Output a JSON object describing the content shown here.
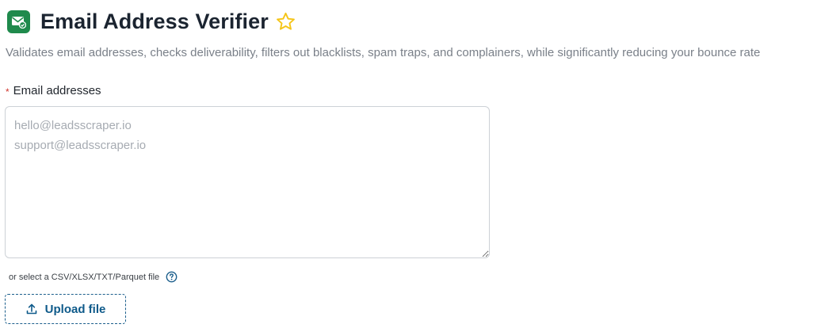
{
  "header": {
    "title": "Email Address Verifier",
    "app_icon": "email-verify-icon",
    "favorite_icon": "star-outline-icon",
    "brand_color": "#1f8a4c",
    "star_color": "#f5c518"
  },
  "subtitle": "Validates email addresses, checks deliverability, filters out blacklists, spam traps, and complainers, while significantly reducing your bounce rate",
  "form": {
    "emails_field": {
      "required_marker": "*",
      "label": "Email addresses",
      "value": "",
      "placeholder": "hello@leadsscraper.io\nsupport@leadsscraper.io"
    },
    "file_hint": "or select a CSV/XLSX/TXT/Parquet file",
    "help_icon": "question-circle-icon",
    "upload_button": {
      "label": "Upload file",
      "icon": "upload-icon",
      "color": "#0e5a8a"
    }
  }
}
